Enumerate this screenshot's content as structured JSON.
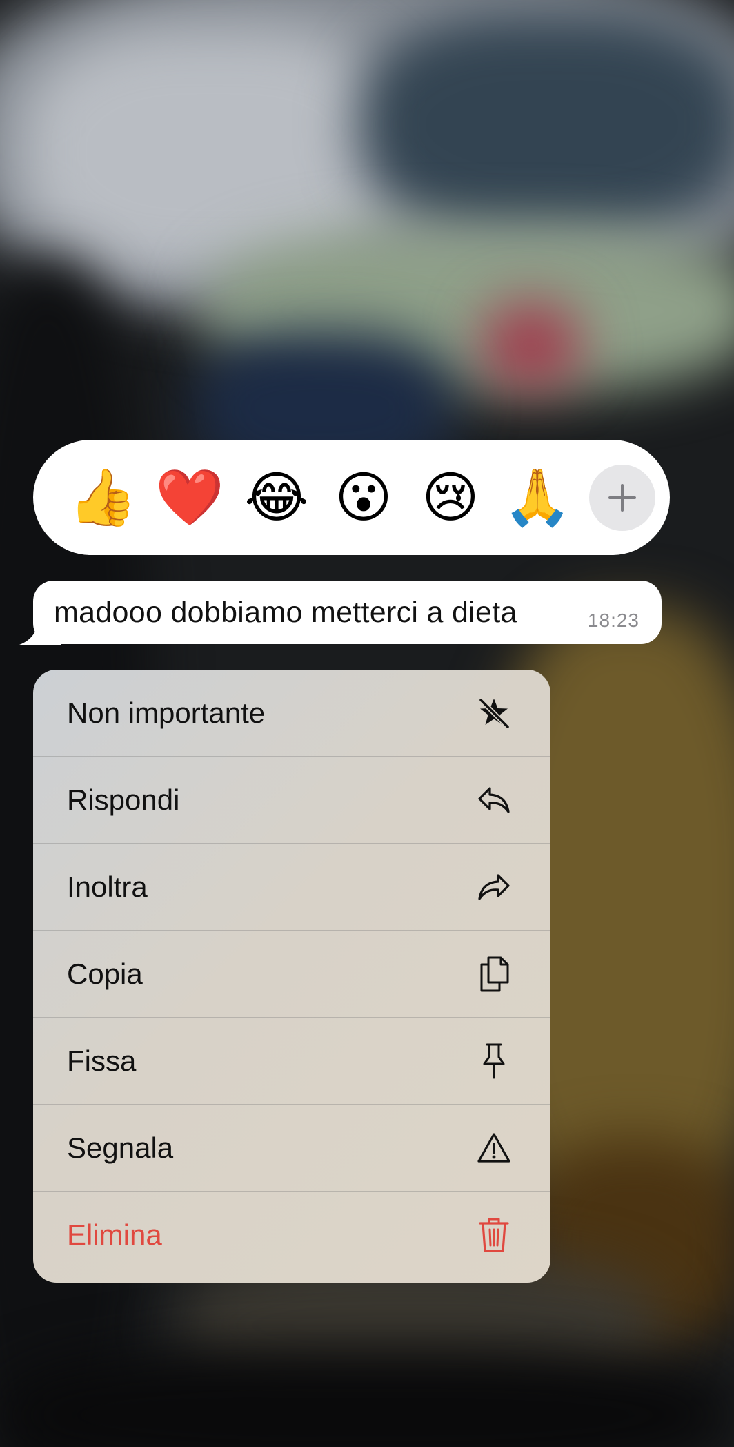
{
  "reactions": {
    "emojis": [
      {
        "name": "thumbs-up-emoji",
        "glyph": "👍"
      },
      {
        "name": "heart-emoji",
        "glyph": "❤️"
      },
      {
        "name": "laughing-emoji",
        "glyph": "😂"
      },
      {
        "name": "surprised-emoji",
        "glyph": "😮"
      },
      {
        "name": "sad-emoji",
        "glyph": "😢"
      },
      {
        "name": "pray-emoji",
        "glyph": "🙏"
      }
    ],
    "more_icon": "plus-icon"
  },
  "message": {
    "text": "madooo dobbiamo metterci a dieta",
    "time": "18:23"
  },
  "menu": {
    "items": [
      {
        "label": "Non importante",
        "icon": "unstar-icon"
      },
      {
        "label": "Rispondi",
        "icon": "reply-icon"
      },
      {
        "label": "Inoltra",
        "icon": "forward-icon"
      },
      {
        "label": "Copia",
        "icon": "copy-icon"
      },
      {
        "label": "Fissa",
        "icon": "pin-icon"
      },
      {
        "label": "Segnala",
        "icon": "warning-icon"
      },
      {
        "label": "Elimina",
        "icon": "trash-icon",
        "destructive": true
      }
    ]
  },
  "colors": {
    "destructive": "#e0483f",
    "bubble": "#ffffff",
    "time_text": "#8a8a8e"
  }
}
